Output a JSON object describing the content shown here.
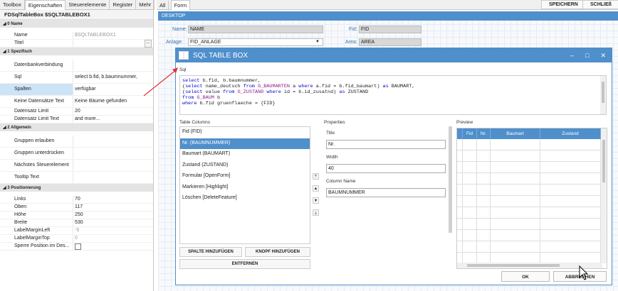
{
  "left_tabs": [
    "Toolbox",
    "Eigenschaften",
    "Steuerelemente",
    "Register",
    "Mehr"
  ],
  "panel_title": "FDSqlTableBox $SQLTABLEBOX1",
  "sections": {
    "name": "0 Name",
    "spez": "1 Spezifisch",
    "allg": "2 Allgemein",
    "pos": "3 Positionierung"
  },
  "props_name": [
    {
      "k": "Name",
      "v": "$SQLTABLEBOX1"
    },
    {
      "k": "Titel",
      "v": ""
    }
  ],
  "props_spez": [
    {
      "k": "Datenbankverbindung",
      "v": ""
    },
    {
      "k": "Sql",
      "v": "select b.fid, b.baumnummer,"
    },
    {
      "k": "Spalten",
      "v": "verfügbar"
    },
    {
      "k": "Keine Datensätze Text",
      "v": "Keine Bäume gefunden"
    },
    {
      "k": "Datensatz Limit",
      "v": "20"
    },
    {
      "k": "Datensatz Limit Text",
      "v": "and more..."
    }
  ],
  "props_allg": [
    {
      "k": "Gruppen erlauben",
      "v": ""
    },
    {
      "k": "Gruppen unterdrücken",
      "v": ""
    },
    {
      "k": "Nächstes Steuerelement",
      "v": ""
    },
    {
      "k": "Tooltip Text",
      "v": ""
    }
  ],
  "props_pos": [
    {
      "k": "Links",
      "v": "70"
    },
    {
      "k": "Oben",
      "v": "117"
    },
    {
      "k": "Höhe",
      "v": "250"
    },
    {
      "k": "Breite",
      "v": "530"
    },
    {
      "k": "LabelMarginLeft",
      "v": "-5"
    },
    {
      "k": "LabelMarginTop",
      "v": "0"
    },
    {
      "k": "Sperre Position im Des...",
      "v": ""
    }
  ],
  "right_tabs": [
    "All",
    "Form"
  ],
  "save_label": "SPEICHERN",
  "close_label": "SCHLIEß",
  "desktop_label": "DESKTOP",
  "form": {
    "name_label": "Name:",
    "name_value": "NAME",
    "fid_label": "Fid:",
    "fid_value": "FID",
    "anlage_label": "Anlage:",
    "anlage_value": "FID_ANLAGE",
    "area_label": "Area:",
    "area_value": "AREA"
  },
  "dialog": {
    "title": "SQL TABLE BOX",
    "sql_label": "Sql",
    "sql_lines": [
      "select b.fid, b.baumnummer,",
      "(select name_deutsch from G_BAUMARTEN a where a.fid = b.fid_baumart) as BAUMART,",
      "(select value from G_ZUSTAND where id = b.id_zusatnd) as ZUSTAND",
      "from G_BAUM b",
      "where b.fid gruenflaeche = {FID}"
    ],
    "table_columns_label": "Table Columns",
    "columns": [
      "Fid (FID)",
      "Nr. (BAUMNUMMER)",
      "Baumart (BAUMART)",
      "Zustand (ZUSTAND)",
      "Formular [OpenForm]",
      "Markieren [Highlight]",
      "Löschen [DeleteFeature]"
    ],
    "add_column": "SPALTE HINZUFÜGEN",
    "add_button": "KNOPF HINZUFÜGEN",
    "remove": "ENTFERNEN",
    "properties_label": "Properties",
    "title_label": "Title",
    "title_value": "Nr.",
    "width_label": "Width",
    "width_value": "40",
    "colname_label": "Column Name",
    "colname_value": "BAUMNUMMER",
    "preview_label": "Preview",
    "preview_headers": [
      "Fid",
      "Nr.",
      "Baumart",
      "Zustand"
    ],
    "ok": "OK",
    "cancel": "ABBRECHEN"
  },
  "colors": {
    "accent": "#4f8fcc",
    "selection": "#cde4f7"
  }
}
